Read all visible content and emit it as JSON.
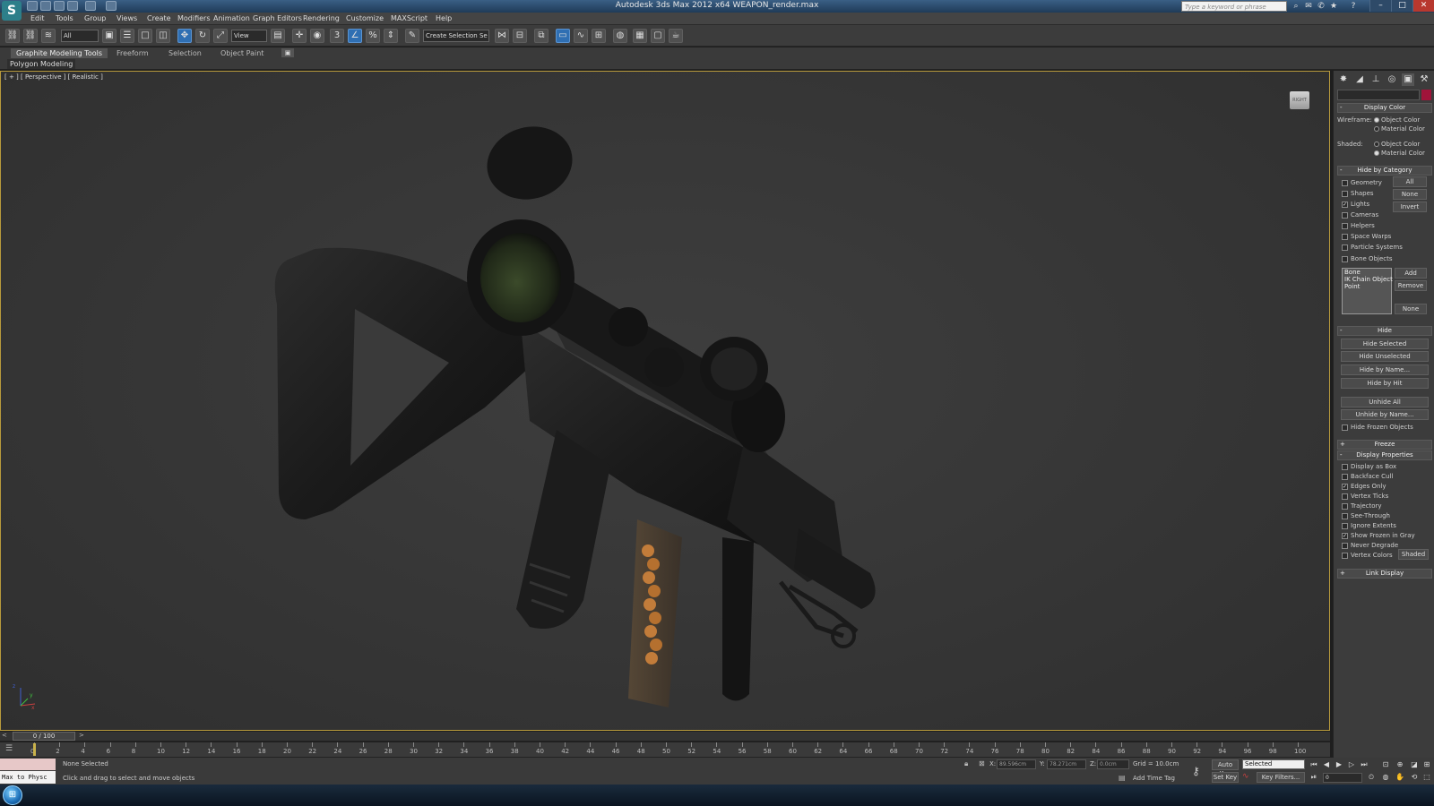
{
  "window": {
    "title": "Autodesk 3ds Max  2012 x64    WEAPON_render.max",
    "search_placeholder": "Type a keyword or phrase",
    "logo": "S"
  },
  "menu": [
    "Edit",
    "Tools",
    "Group",
    "Views",
    "Create",
    "Modifiers",
    "Animation",
    "Graph Editors",
    "Rendering",
    "Customize",
    "MAXScript",
    "Help"
  ],
  "toolbar": {
    "filter_dropdown": "All",
    "reference_coord": "View",
    "selection_set": "Create Selection Se"
  },
  "ribbon": {
    "tabs": [
      "Graphite Modeling Tools",
      "Freeform",
      "Selection",
      "Object Paint"
    ],
    "active_tab": "Graphite Modeling Tools",
    "subtab": "Polygon Modeling"
  },
  "viewport": {
    "label": "[ + ] [ Perspective ] [ Realistic ]",
    "viewcube_label": "RIGHT",
    "axis": {
      "x": "x",
      "y": "y",
      "z": "z"
    }
  },
  "command_panel": {
    "display_color": {
      "title": "Display Color",
      "wireframe_label": "Wireframe:",
      "shaded_label": "Shaded:",
      "object_color": "Object Color",
      "material_color": "Material Color",
      "wireframe_selected": "Object Color",
      "shaded_selected": "Material Color"
    },
    "hide_by_category": {
      "title": "Hide by Category",
      "items": [
        {
          "label": "Geometry",
          "checked": false
        },
        {
          "label": "Shapes",
          "checked": false
        },
        {
          "label": "Lights",
          "checked": true
        },
        {
          "label": "Cameras",
          "checked": false
        },
        {
          "label": "Helpers",
          "checked": false
        },
        {
          "label": "Space Warps",
          "checked": false
        },
        {
          "label": "Particle Systems",
          "checked": false
        },
        {
          "label": "Bone Objects",
          "checked": false
        }
      ],
      "btn_all": "All",
      "btn_none": "None",
      "btn_invert": "Invert",
      "list": [
        "Bone",
        "IK Chain Object",
        "Point"
      ],
      "btn_add": "Add",
      "btn_remove": "Remove",
      "btn_list_none": "None"
    },
    "hide": {
      "title": "Hide",
      "buttons": [
        "Hide Selected",
        "Hide Unselected",
        "Hide by Name...",
        "Hide by Hit"
      ],
      "buttons2": [
        "Unhide All",
        "Unhide by Name..."
      ],
      "hide_frozen": "Hide Frozen Objects"
    },
    "freeze": {
      "title": "Freeze"
    },
    "display_properties": {
      "title": "Display Properties",
      "items": [
        {
          "label": "Display as Box",
          "checked": false
        },
        {
          "label": "Backface Cull",
          "checked": false
        },
        {
          "label": "Edges Only",
          "checked": true
        },
        {
          "label": "Vertex Ticks",
          "checked": false
        },
        {
          "label": "Trajectory",
          "checked": false
        },
        {
          "label": "See-Through",
          "checked": false
        },
        {
          "label": "Ignore Extents",
          "checked": false
        },
        {
          "label": "Show Frozen in Gray",
          "checked": true
        },
        {
          "label": "Never Degrade",
          "checked": false
        },
        {
          "label": "Vertex Colors",
          "checked": false
        }
      ],
      "shaded_btn": "Shaded"
    },
    "link_display": {
      "title": "Link Display"
    }
  },
  "timeline": {
    "frame_counter": "0 / 100",
    "ticks": [
      0,
      2,
      4,
      6,
      8,
      10,
      12,
      14,
      16,
      18,
      20,
      22,
      24,
      26,
      28,
      30,
      32,
      34,
      36,
      38,
      40,
      42,
      44,
      46,
      48,
      50,
      52,
      54,
      56,
      58,
      60,
      62,
      64,
      66,
      68,
      70,
      72,
      74,
      76,
      78,
      80,
      82,
      84,
      86,
      88,
      90,
      92,
      94,
      96,
      98,
      100
    ]
  },
  "status": {
    "maxscript_mini": "Max to Physc",
    "selection": "None Selected",
    "prompt": "Click and drag to select and move objects",
    "x_label": "X:",
    "x_value": "89.596cm",
    "y_label": "Y:",
    "y_value": "78.271cm",
    "z_label": "Z:",
    "z_value": "0.0cm",
    "grid": "Grid = 10.0cm",
    "add_time_tag": "Add Time Tag",
    "auto_key": "Auto Key",
    "selected_dd": "Selected",
    "set_key": "Set Key",
    "key_filters": "Key Filters...",
    "frame_field": "0"
  },
  "colors": {
    "accent_active": "#2f6fb3",
    "viewport_border": "#b89a3c",
    "object_color_swatch": "#a0143a",
    "time_marker": "#c9b24b"
  }
}
